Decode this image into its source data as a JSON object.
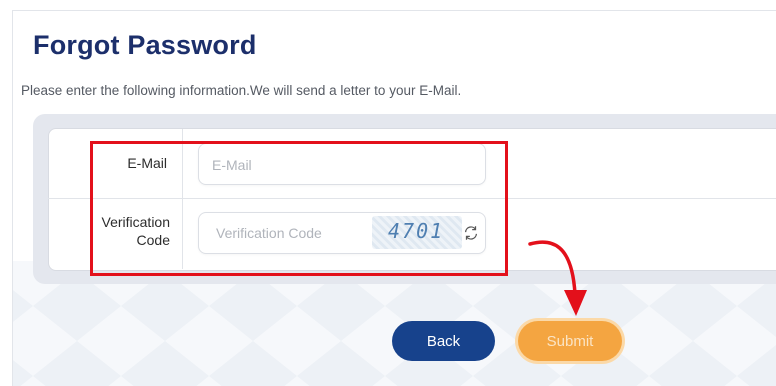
{
  "page": {
    "title": "Forgot Password",
    "subtitle": "Please enter the following information.We will send a letter to your E-Mail."
  },
  "form": {
    "email": {
      "label": "E-Mail",
      "placeholder": "E-Mail",
      "value": ""
    },
    "verification": {
      "label_line1": "Verification",
      "label_line2": "Code",
      "placeholder": "Verification Code",
      "value": "",
      "captcha_text": "4701"
    }
  },
  "buttons": {
    "back_label": "Back",
    "submit_label": "Submit"
  },
  "colors": {
    "title": "#1c2f6b",
    "back_button": "#17428c",
    "submit_button": "#f4a541",
    "highlight": "#e3101b"
  },
  "icons": {
    "refresh": "refresh-icon"
  }
}
